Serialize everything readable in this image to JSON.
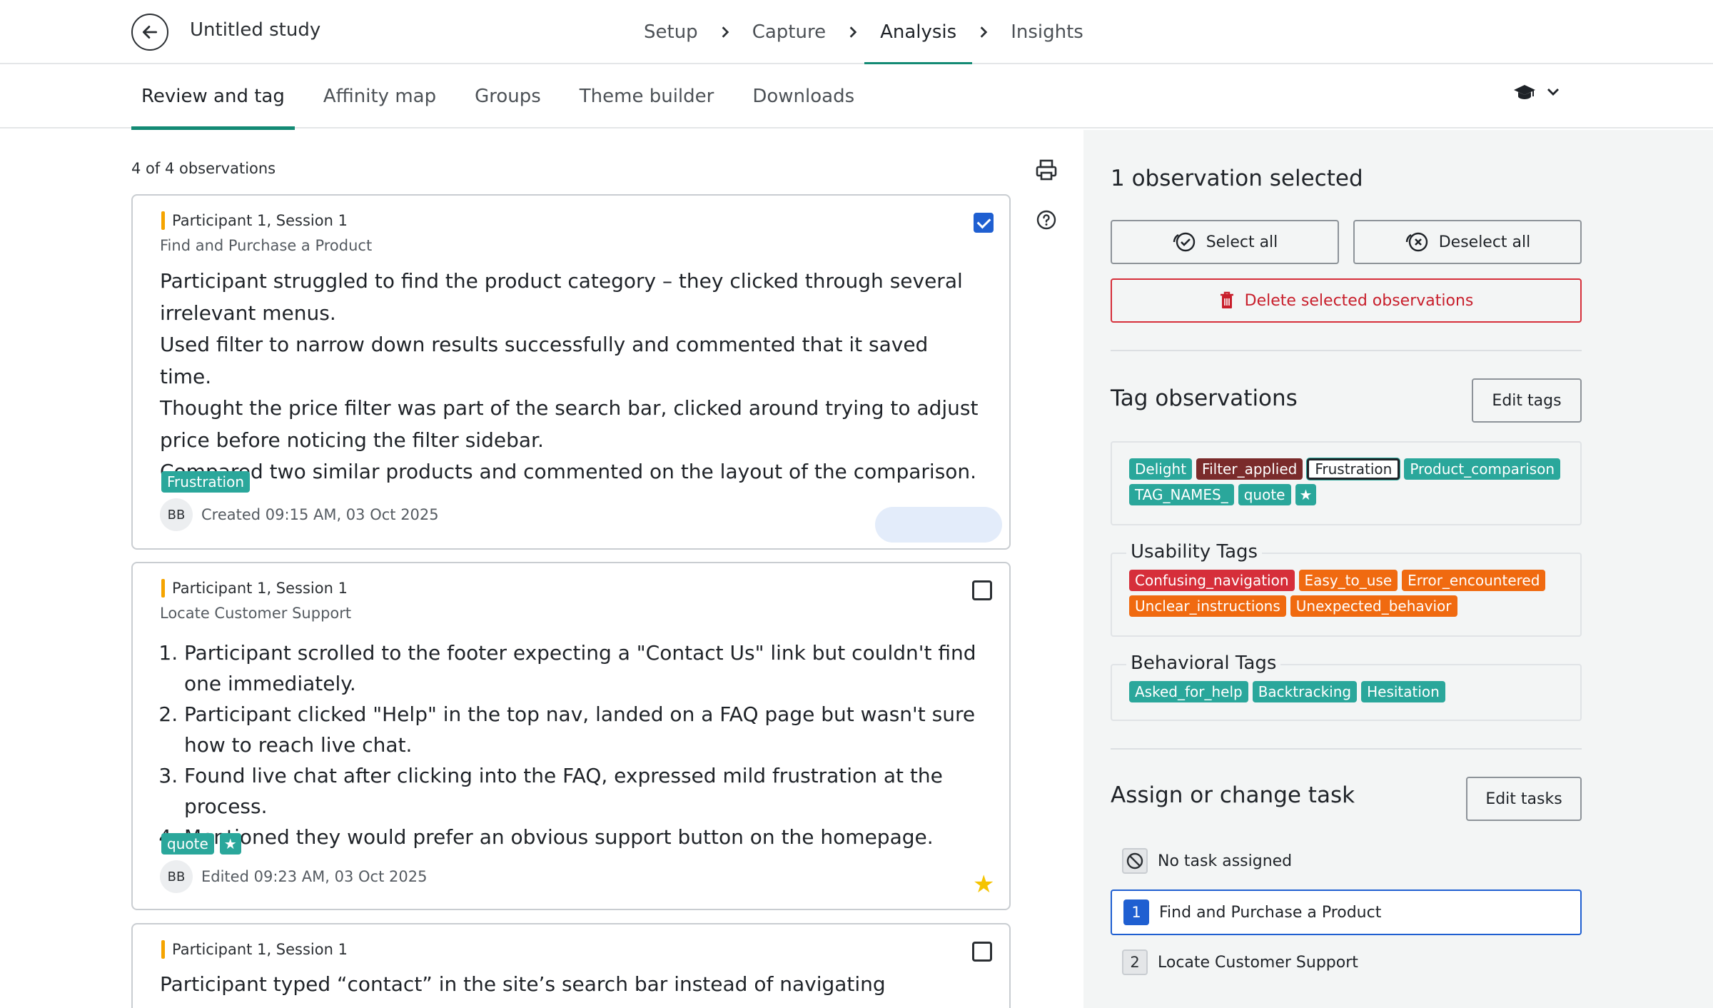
{
  "header": {
    "study_title": "Untitled study",
    "steps": [
      "Setup",
      "Capture",
      "Analysis",
      "Insights"
    ],
    "active_step": "Analysis"
  },
  "subnav": {
    "tabs": [
      "Review and tag",
      "Affinity map",
      "Groups",
      "Theme builder",
      "Downloads"
    ],
    "active_tab": "Review and tag",
    "mode_icon": "graduation-cap-icon"
  },
  "observations": {
    "count_label": "4 of 4 observations",
    "items": [
      {
        "participant": "Participant 1, Session 1",
        "task": "Find and Purchase a Product",
        "lines": [
          "Participant struggled to find the product category – they clicked through several irrelevant menus.",
          "Used filter to narrow down results successfully and commented that it saved time.",
          "Thought the price filter was part of the search bar, clicked around trying to adjust price before noticing the filter sidebar.",
          "Compared two similar products and commented on the layout of the comparison."
        ],
        "tags": [
          "Frustration"
        ],
        "avatar": "BB",
        "timestamp": "Created 09:15 AM, 03 Oct 2025",
        "selected": true
      },
      {
        "participant": "Participant 1, Session 1",
        "task": "Locate Customer Support",
        "list": [
          "Participant scrolled to the footer expecting a \"Contact Us\" link but couldn't find one immediately.",
          "Participant clicked \"Help\" in the top nav, landed on a FAQ page but wasn't sure how to reach live chat.",
          "Found live chat after clicking into the FAQ, expressed mild frustration at the process.",
          "Mentioned they would prefer an obvious support button on the homepage."
        ],
        "tags": [
          "quote",
          "★"
        ],
        "avatar": "BB",
        "timestamp": "Edited 09:23 AM, 03 Oct 2025",
        "selected": false,
        "favorite": true
      },
      {
        "participant": "Participant 1, Session 1",
        "text": "Participant typed “contact” in the site’s search bar instead of navigating manually, and",
        "selected": false
      }
    ]
  },
  "panel": {
    "selected_label": "1 observation selected",
    "select_all": "Select all",
    "deselect_all": "Deselect all",
    "delete_selected": "Delete selected observations",
    "tag_section_title": "Tag observations",
    "edit_tags": "Edit tags",
    "general_tags": [
      {
        "label": "Delight",
        "color": "#2aa79b"
      },
      {
        "label": "Filter_applied",
        "color": "#7a2b2b"
      },
      {
        "label": "Frustration",
        "color": "#ffffff"
      },
      {
        "label": "Product_comparison",
        "color": "#2aa79b"
      },
      {
        "label": "TAG_NAMES_",
        "color": "#2aa79b"
      },
      {
        "label": "quote",
        "color": "#2aa79b"
      },
      {
        "label": "★",
        "color": "#2aa79b"
      }
    ],
    "usability_title": "Usability Tags",
    "usability_tags": [
      "Confusing_navigation",
      "Easy_to_use",
      "Error_encountered",
      "Unclear_instructions",
      "Unexpected_behavior"
    ],
    "behavioral_title": "Behavioral Tags",
    "behavioral_tags": [
      "Asked_for_help",
      "Backtracking",
      "Hesitation"
    ],
    "task_section_title": "Assign or change task",
    "edit_tasks": "Edit tasks",
    "tasks": [
      {
        "num": "",
        "label": "No task assigned"
      },
      {
        "num": "1",
        "label": "Find and Purchase a Product"
      },
      {
        "num": "2",
        "label": "Locate Customer Support"
      }
    ]
  }
}
